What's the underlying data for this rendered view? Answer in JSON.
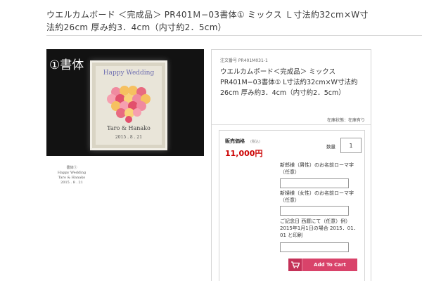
{
  "product": {
    "title": "ウエルカムボード ＜完成品＞ PR401Ｍ−03書体① ミックス Ｌ寸法約32cm×W寸法約26cm 厚み約3．4cm（内寸約2．5cm）"
  },
  "photo": {
    "label": "①書体",
    "frame_header": "Happy Wedding",
    "frame_names": "Taro & Hanako",
    "frame_date": "2015 . 8 . 21"
  },
  "thumbnail": {
    "lines": [
      "書体①",
      "Happy Wedding",
      "Taro & Hanako",
      "2015 . 8 . 21"
    ]
  },
  "panel": {
    "order_no": "注文番号 PR401M031-1",
    "name": "ウエルカムボード＜完成品＞ ミックス PR401M−03書体① L寸法約32cm×W寸法約26cm 厚み約3．4cm（内寸約2．5cm）",
    "stock": "在庫状態：在庫有り",
    "price_label": "販売価格",
    "tax_label": "(税込)",
    "price": "11,000円",
    "qty_label": "数量",
    "qty_value": "1",
    "fields": [
      {
        "label": "新郎様（男性）のお名前ローマ字（任意）"
      },
      {
        "label": "新婦様（女性）のお名前ローマ字（任意）"
      },
      {
        "label": "ご記念日 西暦にて（任意）例）2015年1月1日の場合 2015．01．01 と印刷"
      }
    ],
    "cart_label": "Add To Cart"
  },
  "colors": {
    "price": "#cc0000",
    "cart_button": "#d9436a",
    "photo_bg": "#121212"
  },
  "icons": [
    "cart-icon"
  ]
}
